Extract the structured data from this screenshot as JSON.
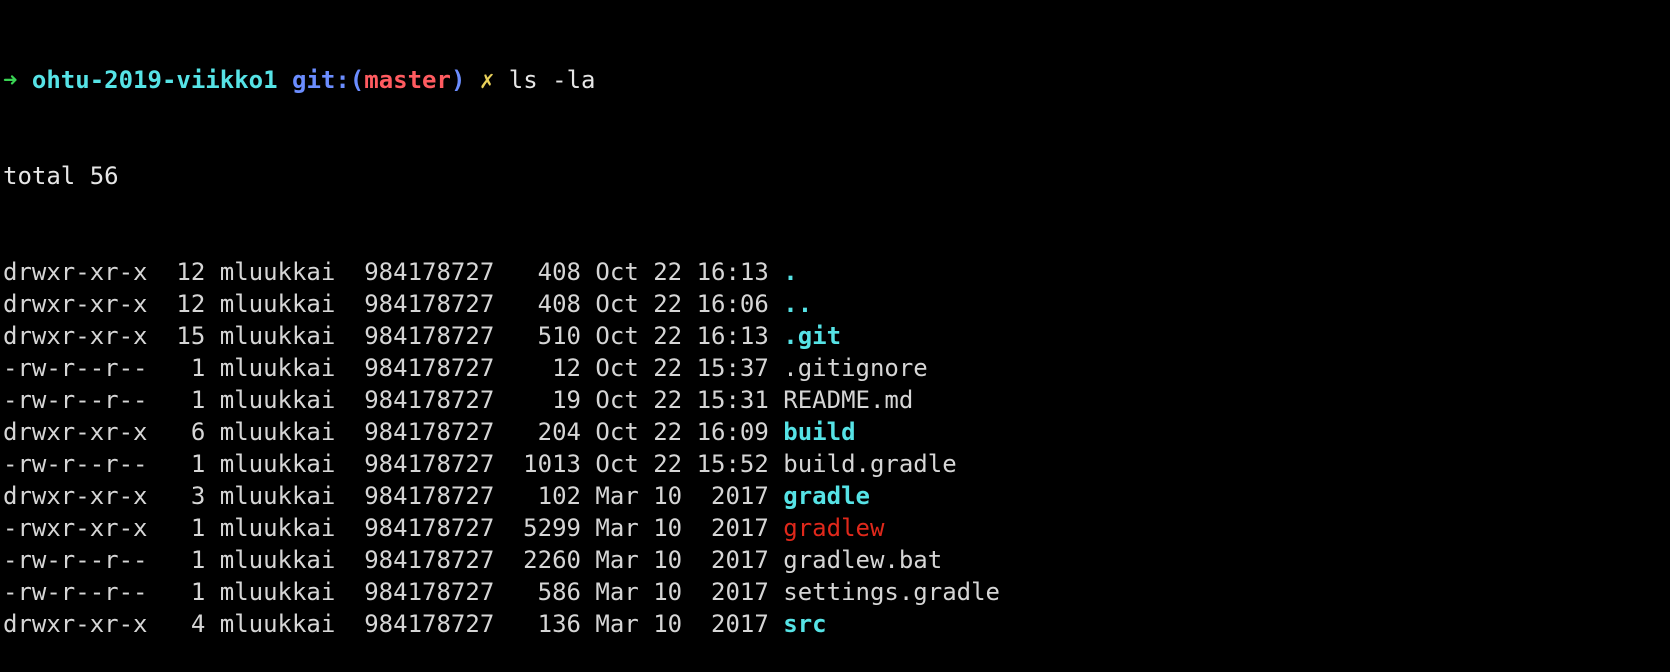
{
  "prompt": {
    "arrow": "➜",
    "directory": "ohtu-2019-viikko1",
    "git_label": "git:(",
    "branch": "master",
    "git_close": ")",
    "dirty_marker": "✗",
    "command": "ls -la"
  },
  "total_line": "total 56",
  "colors": {
    "background": "#000000",
    "directory_name": "#56e3e6",
    "executable_name": "#e0281b",
    "prompt_arrow": "#39d353",
    "git_label": "#6b8dff",
    "branch": "#ff5b60",
    "dirty_marker": "#e8d05a"
  },
  "entries": [
    {
      "prefix": "drwxr-xr-x  12 mluukkai  984178727   408 Oct 22 16:13 ",
      "name": ".",
      "kind": "dir"
    },
    {
      "prefix": "drwxr-xr-x  12 mluukkai  984178727   408 Oct 22 16:06 ",
      "name": "..",
      "kind": "dir"
    },
    {
      "prefix": "drwxr-xr-x  15 mluukkai  984178727   510 Oct 22 16:13 ",
      "name": ".git",
      "kind": "dir"
    },
    {
      "prefix": "-rw-r--r--   1 mluukkai  984178727    12 Oct 22 15:37 ",
      "name": ".gitignore",
      "kind": "file"
    },
    {
      "prefix": "-rw-r--r--   1 mluukkai  984178727    19 Oct 22 15:31 ",
      "name": "README.md",
      "kind": "file"
    },
    {
      "prefix": "drwxr-xr-x   6 mluukkai  984178727   204 Oct 22 16:09 ",
      "name": "build",
      "kind": "dir"
    },
    {
      "prefix": "-rw-r--r--   1 mluukkai  984178727  1013 Oct 22 15:52 ",
      "name": "build.gradle",
      "kind": "file"
    },
    {
      "prefix": "drwxr-xr-x   3 mluukkai  984178727   102 Mar 10  2017 ",
      "name": "gradle",
      "kind": "dir"
    },
    {
      "prefix": "-rwxr-xr-x   1 mluukkai  984178727  5299 Mar 10  2017 ",
      "name": "gradlew",
      "kind": "exec"
    },
    {
      "prefix": "-rw-r--r--   1 mluukkai  984178727  2260 Mar 10  2017 ",
      "name": "gradlew.bat",
      "kind": "file"
    },
    {
      "prefix": "-rw-r--r--   1 mluukkai  984178727   586 Mar 10  2017 ",
      "name": "settings.gradle",
      "kind": "file"
    },
    {
      "prefix": "drwxr-xr-x   4 mluukkai  984178727   136 Mar 10  2017 ",
      "name": "src",
      "kind": "dir"
    }
  ]
}
